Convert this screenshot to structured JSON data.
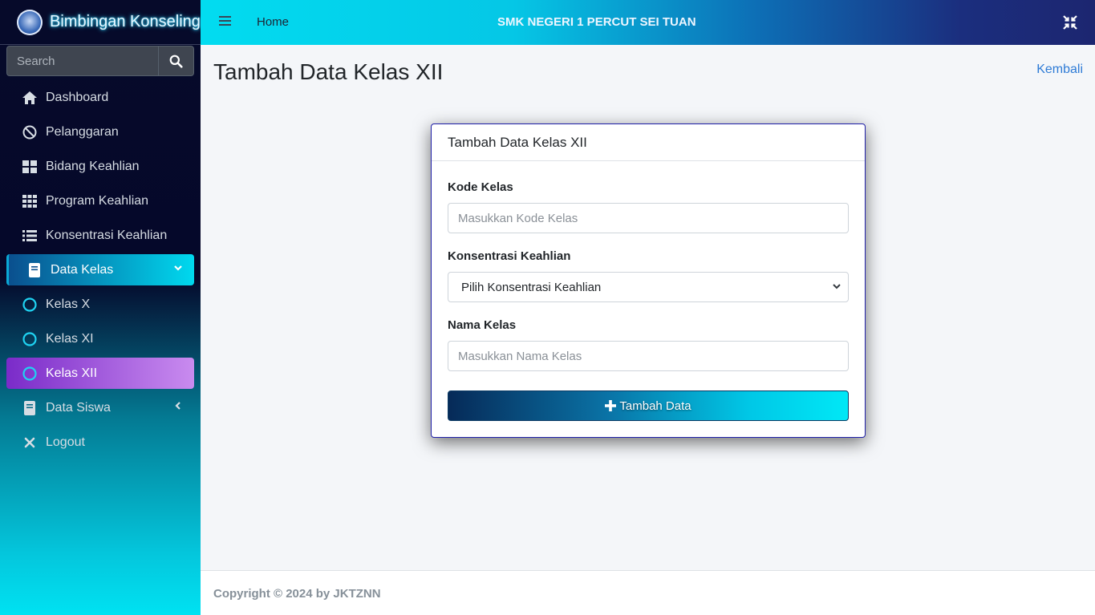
{
  "brand": {
    "name": "Bimbingan Konseling"
  },
  "search": {
    "placeholder": "Search"
  },
  "sidebar": {
    "items": [
      {
        "label": "Dashboard",
        "icon": "home-icon"
      },
      {
        "label": "Pelanggaran",
        "icon": "ban-icon"
      },
      {
        "label": "Bidang Keahlian",
        "icon": "grid-icon"
      },
      {
        "label": "Program Keahlian",
        "icon": "th-icon"
      },
      {
        "label": "Konsentrasi Keahlian",
        "icon": "list-icon"
      },
      {
        "label": "Data Kelas",
        "icon": "book-icon",
        "expanded": true
      },
      {
        "label": "Kelas X",
        "icon": "circle-icon"
      },
      {
        "label": "Kelas XI",
        "icon": "circle-icon"
      },
      {
        "label": "Kelas XII",
        "icon": "circle-icon",
        "active": true
      },
      {
        "label": "Data Siswa",
        "icon": "book-icon",
        "expanded": false
      },
      {
        "label": "Logout",
        "icon": "close-icon"
      }
    ]
  },
  "topbar": {
    "home": "Home",
    "school": "SMK NEGERI 1 PERCUT SEI TUAN"
  },
  "main": {
    "title": "Tambah Data Kelas XII",
    "back": "Kembali"
  },
  "form": {
    "header": "Tambah Data Kelas XII",
    "kode_label": "Kode Kelas",
    "kode_placeholder": "Masukkan Kode Kelas",
    "konsentrasi_label": "Konsentrasi Keahlian",
    "konsentrasi_selected": "Pilih Konsentrasi Keahlian",
    "nama_label": "Nama Kelas",
    "nama_placeholder": "Masukkan Nama Kelas",
    "submit": "Tambah Data"
  },
  "footer": {
    "text": "Copyright © 2024 by JKTZNN"
  },
  "colors": {
    "accent_cyan": "#00e2f2",
    "active_purple": "#7a2bc9",
    "link_blue": "#2e7bd6"
  }
}
